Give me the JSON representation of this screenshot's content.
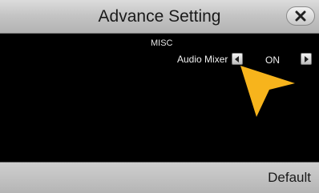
{
  "header": {
    "title": "Advance Setting",
    "close_icon": "close-x-icon"
  },
  "section": {
    "label": "MISC"
  },
  "setting": {
    "label": "Audio Mixer",
    "value": "ON",
    "prev_icon": "triangle-left-icon",
    "next_icon": "triangle-right-icon"
  },
  "footer": {
    "default_label": "Default"
  },
  "colors": {
    "pointer": "#f7b41c",
    "bar": "#c4c4c4",
    "content_bg": "#000000"
  }
}
